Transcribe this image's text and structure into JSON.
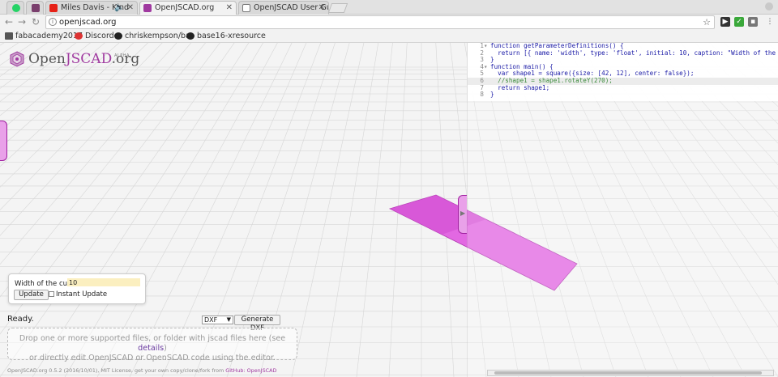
{
  "browser": {
    "tabs": [
      {
        "title": "",
        "icon": "whatsapp-icon",
        "color": "#25d366"
      },
      {
        "title": "",
        "icon": "app-icon",
        "color": "#7a3f6d"
      },
      {
        "title": "Miles Davis - Kind",
        "icon": "youtube-icon",
        "color": "#e62117"
      },
      {
        "title": "OpenJSCAD.org",
        "icon": "openjscad-icon",
        "color": "#a03aa0"
      },
      {
        "title": "OpenJSCAD User Gu",
        "icon": "wiki-icon",
        "color": "#555555"
      }
    ],
    "url": "openjscad.org",
    "bookmarks": [
      {
        "label": "fabacademy2017",
        "icon": "folder-icon"
      },
      {
        "label": "Discord",
        "icon": "discord-icon"
      },
      {
        "label": "chriskempson/ba:",
        "icon": "github-icon"
      },
      {
        "label": "base16-xresource",
        "icon": "github-icon"
      }
    ]
  },
  "app": {
    "logo_prefix": "Open",
    "logo_highlight": "JSCAD",
    "logo_suffix": ".org",
    "logo_badge": "ALPHA",
    "code_lines": [
      {
        "num": "1",
        "fold": "▾",
        "text": "function getParameterDefinitions() {"
      },
      {
        "num": "2",
        "fold": "",
        "text": "  return [{ name: 'width', type: 'float', initial: 10, caption: \"Width of the cube:\""
      },
      {
        "num": "3",
        "fold": "",
        "text": "}"
      },
      {
        "num": "4",
        "fold": "▾",
        "text": "function main() {"
      },
      {
        "num": "5",
        "fold": "",
        "text": "  var shape1 = square({size: [42, 12], center: false});"
      },
      {
        "num": "6",
        "fold": "",
        "text": "  //shape1 = shape1.rotateY(270);"
      },
      {
        "num": "7",
        "fold": "",
        "text": "  return shape1;"
      },
      {
        "num": "8",
        "fold": "",
        "text": "}"
      }
    ],
    "params": {
      "label": "Width of the cube:",
      "value": "10",
      "update_label": "Update",
      "instant_label": "Instant Update"
    },
    "status": "Ready.",
    "format": "DXF",
    "generate_label": "Generate DXF",
    "drop_line1": "Drop one or more supported files, or folder with jscad files here (see ",
    "drop_link": "details",
    "drop_line1_end": ")",
    "drop_line2": "or directly edit OpenJSCAD or OpenSCAD code using the editor.",
    "footer_text": "OpenJSCAD.org 0.5.2 (2016/10/01), MIT License, get your own copy/clone/fork from ",
    "footer_link": "GitHub: OpenJSCAD",
    "shape_color": "#e86be8"
  }
}
